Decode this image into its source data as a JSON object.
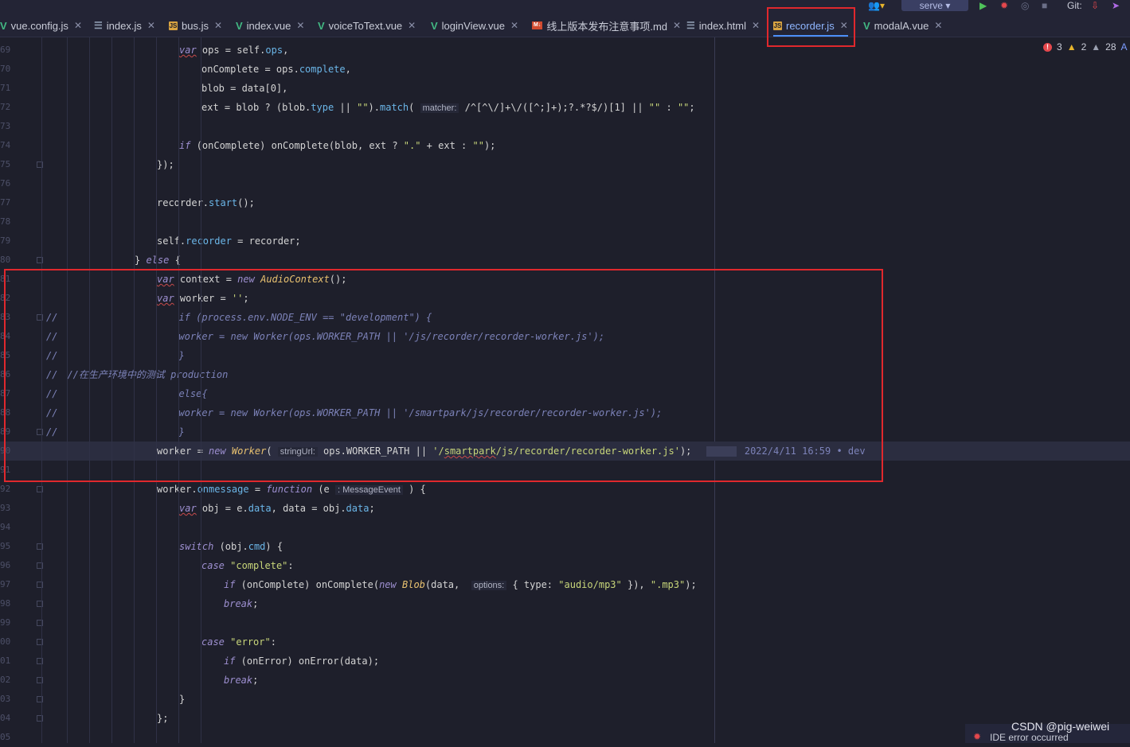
{
  "tabs": [
    {
      "label": "vue.config.js",
      "icon": "vue-icon"
    },
    {
      "label": "index.js",
      "icon": "list-icon"
    },
    {
      "label": "bus.js",
      "icon": "js-icon"
    },
    {
      "label": "index.vue",
      "icon": "vue-icon"
    },
    {
      "label": "voiceToText.vue",
      "icon": "vue-icon"
    },
    {
      "label": "loginView.vue",
      "icon": "vue-icon"
    },
    {
      "label": "线上版本发布注意事项.md",
      "icon": "md-icon"
    },
    {
      "label": "index.html",
      "icon": "list-icon"
    },
    {
      "label": "recorder.js",
      "icon": "js-icon",
      "active": true
    },
    {
      "label": "modalA.vue",
      "icon": "vue-icon"
    }
  ],
  "toolbar": {
    "run_config": "serve",
    "git_label": "Git:"
  },
  "inspections": {
    "errors": "3",
    "warnings": "2",
    "weak_warnings": "28",
    "extra": "A"
  },
  "code_lines": [
    {
      "num": "69",
      "text": "var ops = self.ops,"
    },
    {
      "num": "70",
      "text": "onComplete = ops.complete,"
    },
    {
      "num": "71",
      "text": "blob = data[0],"
    },
    {
      "num": "72",
      "text": "ext = blob ? (blob.type || \"\").match( matcher: /^[^\\/]+\\/([^;]+);?.*?$/)[1] || \"\" : \"\";"
    },
    {
      "num": "73",
      "text": ""
    },
    {
      "num": "74",
      "text": "if (onComplete) onComplete(blob, ext ? \".\" + ext : \"\");"
    },
    {
      "num": "75",
      "text": "});"
    },
    {
      "num": "76",
      "text": ""
    },
    {
      "num": "77",
      "text": "recorder.start();"
    },
    {
      "num": "78",
      "text": ""
    },
    {
      "num": "79",
      "text": "self.recorder = recorder;"
    },
    {
      "num": "80",
      "text": "} else {"
    },
    {
      "num": "81",
      "text": "var context = new AudioContext();"
    },
    {
      "num": "82",
      "text": "var worker = '';"
    },
    {
      "num": "83",
      "text": "//    if (process.env.NODE_ENV == \"development\") {"
    },
    {
      "num": "84",
      "text": "//        worker = new Worker(ops.WORKER_PATH || '/js/recorder/recorder-worker.js');"
    },
    {
      "num": "85",
      "text": "//    }"
    },
    {
      "num": "86",
      "text": "// //在生产环境中的测试 production"
    },
    {
      "num": "87",
      "text": "//    else{"
    },
    {
      "num": "88",
      "text": "//        worker = new Worker(ops.WORKER_PATH || '/smartpark/js/recorder/recorder-worker.js');"
    },
    {
      "num": "89",
      "text": "//    }"
    },
    {
      "num": "90",
      "text": "worker = new Worker( stringUrl: ops.WORKER_PATH || '/smartpark/js/recorder/recorder-worker.js');"
    },
    {
      "num": "91",
      "text": ""
    },
    {
      "num": "92",
      "text": "worker.onmessage = function (e : MessageEvent ) {"
    },
    {
      "num": "93",
      "text": "var obj = e.data, data = obj.data;"
    },
    {
      "num": "94",
      "text": ""
    },
    {
      "num": "95",
      "text": "switch (obj.cmd) {"
    },
    {
      "num": "96",
      "text": "case \"complete\":"
    },
    {
      "num": "97",
      "text": "if (onComplete) onComplete(new Blob(data,  options: { type: \"audio/mp3\" }), \".mp3\");"
    },
    {
      "num": "98",
      "text": "break;"
    },
    {
      "num": "99",
      "text": ""
    },
    {
      "num": "100",
      "text": "case \"error\":"
    },
    {
      "num": "101",
      "text": "if (onError) onError(data);"
    },
    {
      "num": "102",
      "text": "break;"
    },
    {
      "num": "103",
      "text": "}"
    },
    {
      "num": "104",
      "text": "};"
    },
    {
      "num": "105",
      "text": ""
    }
  ],
  "blame": {
    "text": "2022/4/11 16:59 • dev"
  },
  "watermark": "CSDN @pig-weiwei",
  "status": {
    "ide_error": "IDE error occurred"
  },
  "colors": {
    "highlight_box": "#e0282d",
    "background": "#1e1f2b",
    "active_tab_underline": "#4c8ff7"
  }
}
